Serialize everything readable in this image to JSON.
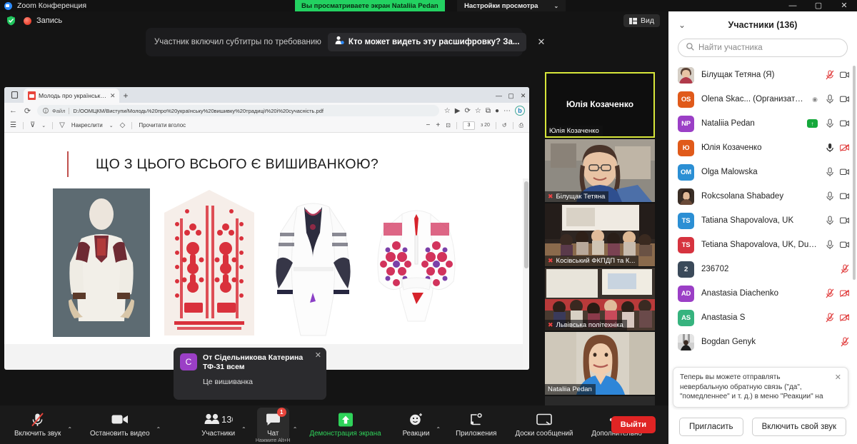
{
  "window": {
    "app_title": "Zoom Конференция",
    "share_banner": "Вы просматриваете экран Nataliia Pedan",
    "share_settings": "Настройки просмотра",
    "minimize": "—",
    "maximize": "▢",
    "close": "✕"
  },
  "zoom_header": {
    "record_label": "Запись",
    "view_label": "Вид"
  },
  "captions": {
    "text": "Участник включил субтитры по требованию",
    "pill": "Кто может видеть эту расшифровку? За...",
    "close": "✕"
  },
  "browser": {
    "tab_title": "Молодь про українську вишив",
    "tab_close": "✕",
    "new_tab": "+",
    "back": "←",
    "reload": "⟳",
    "file_label": "Файл",
    "url": "D:/ООМЦКМ/Виступи/Молодь%20про%20українську%20вишивку%20традиції%20і%20сучасність.pdf",
    "win_minimize": "—",
    "win_maximize": "▢",
    "win_close": "✕",
    "bing_label": "b"
  },
  "pdf_toolbar": {
    "draw_label": "Накреслити",
    "read_aloud_label": "Прочитати вголос",
    "zoom_out": "−",
    "zoom_in": "+",
    "page_current": "3",
    "page_total": "з 20"
  },
  "slide": {
    "title": "ЩО З ЦЬОГО ВСЬОГО Є ВИШИВАНКОЮ?"
  },
  "video_strip": {
    "tiles": [
      {
        "center_name": "Юлія Козаченко",
        "label": "Юлія Козаченко",
        "muted": false,
        "active": true,
        "kind": "name-only"
      },
      {
        "center_name": "",
        "label": "Білущак Тетяна",
        "muted": true,
        "active": false,
        "kind": "portrait-glasses"
      },
      {
        "center_name": "",
        "label": "Косівський ФКПДП та К...",
        "muted": true,
        "active": false,
        "kind": "classroom-a"
      },
      {
        "center_name": "",
        "label": "Львівська політехніка",
        "muted": true,
        "active": false,
        "kind": "classroom-b"
      },
      {
        "center_name": "",
        "label": "Nataliia Pedan",
        "muted": false,
        "active": false,
        "kind": "portrait-blue"
      }
    ],
    "more": "⌄"
  },
  "chat_toast": {
    "from": "От Сідельникова Катерина ТФ-31 всем",
    "avatar_initial": "С",
    "message": "Це вишиванка",
    "close": "✕"
  },
  "toolbar": {
    "buttons": [
      {
        "label": "Включить звук",
        "icon": "mic-muted-icon",
        "caret": true,
        "badge": null,
        "highlight": false
      },
      {
        "label": "Остановить видео",
        "icon": "camera-icon",
        "caret": true,
        "badge": null,
        "highlight": false
      },
      {
        "label": "Участники",
        "icon": "participants-icon",
        "count": "136",
        "caret": true,
        "badge": null,
        "highlight": false
      },
      {
        "label": "Чат",
        "icon": "chat-icon",
        "caret": true,
        "badge": "1",
        "highlight": true
      },
      {
        "label": "Демонстрация экрана",
        "icon": "share-screen-icon",
        "caret": false,
        "badge": null,
        "highlight": false,
        "green": true
      },
      {
        "label": "Реакции",
        "icon": "reactions-icon",
        "caret": true,
        "badge": null,
        "highlight": false
      },
      {
        "label": "Приложения",
        "icon": "apps-icon",
        "caret": false,
        "badge": null,
        "highlight": false
      },
      {
        "label": "Доски сообщений",
        "icon": "whiteboard-icon",
        "caret": false,
        "badge": null,
        "highlight": false
      },
      {
        "label": "Дополнительно",
        "icon": "more-icon",
        "caret": false,
        "badge": null,
        "highlight": false
      }
    ],
    "leave_label": "Выйти",
    "chat_hint": "Нажмите Alt+H"
  },
  "participants": {
    "title": "Участники (136)",
    "collapse_icon": "⌄",
    "search_placeholder": "Найти участника",
    "rows": [
      {
        "name": "Білущак Тетяна (Я)",
        "initials": "",
        "color": "#8a8a8a",
        "photo": true,
        "mic": "muted",
        "cam": "on",
        "host": false,
        "badge": null
      },
      {
        "name": "Olena Skac...",
        "suffix": "(Организатор)",
        "initials": "OS",
        "color": "#e05a1a",
        "photo": false,
        "mic": "on",
        "cam": "on",
        "host": true,
        "badge": null
      },
      {
        "name": "Nataliia Pedan",
        "initials": "NP",
        "color": "#9b3fc6",
        "photo": false,
        "mic": "on",
        "cam": "on",
        "host": false,
        "badge": "↑"
      },
      {
        "name": "Юлія Козаченко",
        "initials": "Ю",
        "color": "#e05a1a",
        "photo": false,
        "mic": "on-dark",
        "cam": "muted",
        "host": false,
        "badge": null
      },
      {
        "name": "Olga Malowska",
        "initials": "OM",
        "color": "#2b8fd4",
        "photo": false,
        "mic": "on",
        "cam": "on",
        "host": false,
        "badge": null
      },
      {
        "name": "Rokcsolana Shabadey",
        "initials": "",
        "color": "#6b5a4a",
        "photo": true,
        "mic": "on",
        "cam": "on",
        "host": false,
        "badge": null
      },
      {
        "name": "Tatiana Shapovalova, UK",
        "initials": "TS",
        "color": "#2b8fd4",
        "photo": false,
        "mic": "on",
        "cam": "on",
        "host": false,
        "badge": null
      },
      {
        "name": "Tetiana Shapovalova, UK, Dund...",
        "initials": "TS",
        "color": "#d6333f",
        "photo": false,
        "mic": "on",
        "cam": "on",
        "host": false,
        "badge": null
      },
      {
        "name": "236702",
        "initials": "2",
        "color": "#3b4a5a",
        "photo": false,
        "mic": "muted",
        "cam": "none",
        "host": false,
        "badge": null
      },
      {
        "name": "Anastasia Diachenko",
        "initials": "AD",
        "color": "#9b3fc6",
        "photo": false,
        "mic": "muted",
        "cam": "muted",
        "host": false,
        "badge": null
      },
      {
        "name": "Anastasia S",
        "initials": "AS",
        "color": "#36b37e",
        "photo": false,
        "mic": "muted",
        "cam": "muted",
        "host": false,
        "badge": null
      },
      {
        "name": "Bogdan Genyk",
        "initials": "",
        "color": "#444",
        "photo": true,
        "mic": "muted",
        "cam": "none",
        "host": false,
        "badge": null
      }
    ],
    "toast": "Теперь вы можете отправлять невербальную обратную связь (\"да\", \"помедленнее\" и т. д.) в меню \"Реакции\" на панели инструментов",
    "toast_close": "✕",
    "invite_label": "Пригласить",
    "unmute_label": "Включить свой звук"
  },
  "colors": {
    "accent_green": "#23d161",
    "leave_red": "#e02424",
    "badge_red": "#e8453c",
    "active_tile": "#d7e63a"
  }
}
